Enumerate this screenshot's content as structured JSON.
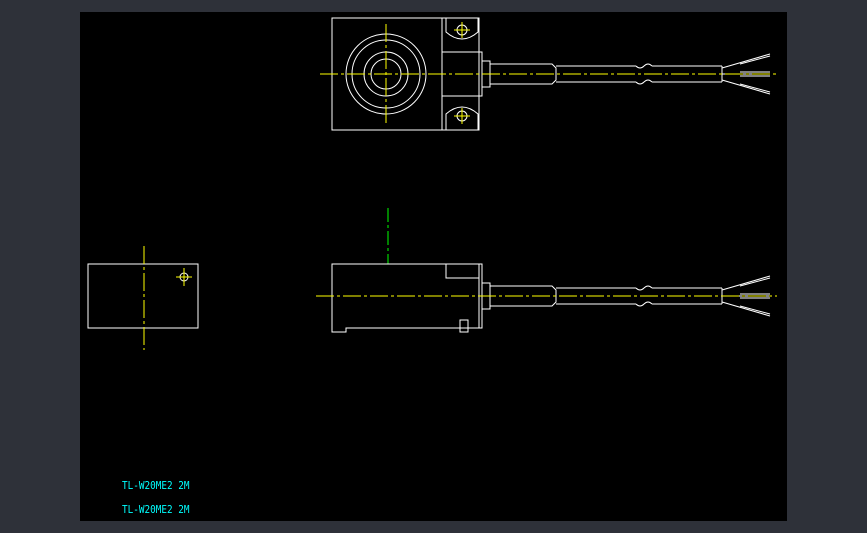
{
  "colors": {
    "frame": "#2e3139",
    "canvas": "#000000",
    "outline": "#ffffff",
    "centerline": "#ffff00",
    "axis_green": "#00ff00",
    "text": "#00ffff"
  },
  "drawing": {
    "labels": [
      {
        "text": "TL-W20ME2 2M"
      },
      {
        "text": "TL-W20ME2 2M"
      }
    ]
  }
}
